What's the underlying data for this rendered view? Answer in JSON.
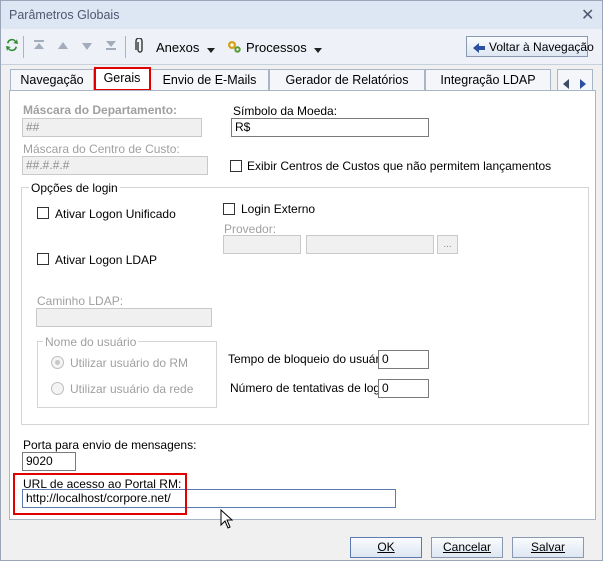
{
  "window": {
    "title": "Parâmetros Globais",
    "close_icon": "close-icon"
  },
  "toolbar": {
    "anexos_label": "Anexos",
    "processos_label": "Processos",
    "voltar_label": "Voltar à Navegação"
  },
  "tabs": [
    {
      "label": "Navegação"
    },
    {
      "label": "Gerais"
    },
    {
      "label": "Envio de E-Mails"
    },
    {
      "label": "Gerador de Relatórios"
    },
    {
      "label": "Integração LDAP"
    }
  ],
  "form": {
    "mascara_departamento_label": "Máscara do Departamento:",
    "mascara_departamento_value": "##",
    "simbolo_moeda_label": "Símbolo da Moeda:",
    "simbolo_moeda_value": "R$",
    "mascara_centro_custo_label": "Máscara do Centro de Custo:",
    "mascara_centro_custo_value": "##.#.#.#",
    "exibir_centros_label": "Exibir Centros de Custos que não permitem lançamentos",
    "opcoes_login_label": "Opções de login",
    "ativar_logon_unificado_label": "Ativar Logon Unificado",
    "login_externo_label": "Login Externo",
    "provedor_label": "Provedor:",
    "provedor_browse": "...",
    "ativar_logon_ldap_label": "Ativar Logon LDAP",
    "caminho_ldap_label": "Caminho LDAP:",
    "nome_usuario_label": "Nome do usuário",
    "utilizar_usuario_rm_label": "Utilizar usuário do RM",
    "utilizar_usuario_rede_label": "Utilizar usuário da rede",
    "tempo_bloqueio_label": "Tempo de bloqueio do usuário:",
    "tempo_bloqueio_value": "0",
    "numero_tentativas_label": "Número de tentativas de login:",
    "numero_tentativas_value": "0",
    "porta_envio_label": "Porta para envio de mensagens:",
    "porta_envio_value": "9020",
    "url_portal_label": "URL de acesso ao Portal RM:",
    "url_portal_value": "http://localhost/corpore.net/"
  },
  "buttons": {
    "ok": "OK",
    "cancelar": "Cancelar",
    "salvar": "Salvar"
  },
  "colors": {
    "highlight": "#e00000",
    "title_bg": "#dde7f3"
  }
}
